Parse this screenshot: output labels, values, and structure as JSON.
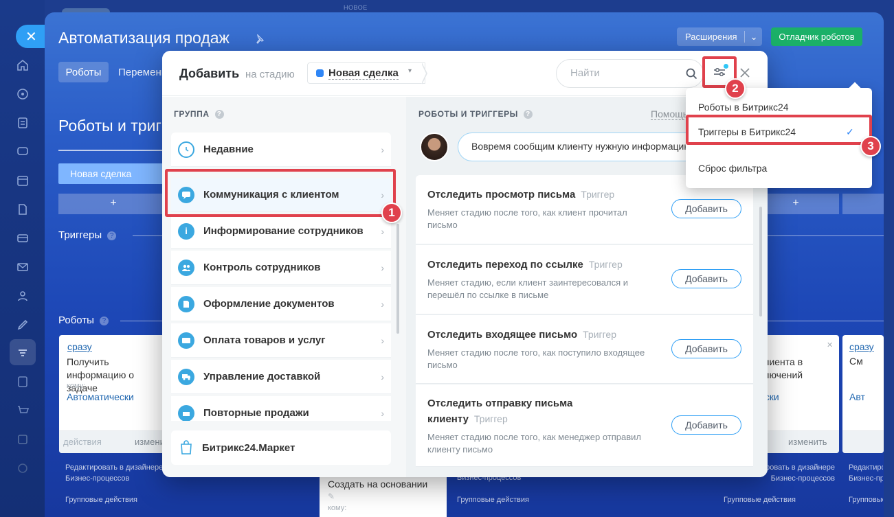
{
  "window": {
    "new_badge": "НОВОЕ"
  },
  "sidebar": {
    "icons": [
      "home-icon",
      "activity-icon",
      "tasks-icon",
      "chat-icon",
      "calendar-icon",
      "documents-icon",
      "card-icon",
      "mail-icon",
      "contacts-icon",
      "sign-icon",
      "filter-icon",
      "form-icon",
      "cart-icon",
      "chart-icon",
      "settings-icon"
    ]
  },
  "page": {
    "title": "Автоматизация продаж",
    "extensions_label": "Расширения",
    "debugger_label": "Отладчик роботов",
    "tabs": [
      "Роботы",
      "Переменные"
    ],
    "bg_title": "Роботы и триггеры",
    "stage": "Новая сделка",
    "plus": "+",
    "triggers_label": "Триггеры",
    "robots_label": "Роботы",
    "cards": [
      {
        "when": "сразу",
        "title": "Получить информацию о задаче",
        "to_label": "кому:",
        "to_value": "Автоматически",
        "foot_left": "действия",
        "foot_right": "изменить"
      },
      {
        "title": "Создать на основании",
        "to_label": "кому:"
      },
      {
        "title_partial": "клиента в",
        "title_partial2": "ключений",
        "to_value": "ески",
        "foot_right": "изменить"
      },
      {
        "when": "сразу",
        "title_partial": "См",
        "to_value": "Авт"
      }
    ],
    "links": {
      "edit_designer_1": "Редактировать в дизайнере",
      "edit_designer_2": "Бизнес-процессов",
      "group_actions": "Групповые действия",
      "edit_designer_short": "Редактировать в дизайнере",
      "bp_short": "Бизнес-процессов"
    }
  },
  "modal": {
    "title": "Добавить",
    "stage_label": "на стадию",
    "stage_value": "Новая сделка",
    "search_placeholder": "Найти",
    "group_header": "ГРУППА",
    "groups": [
      {
        "label": "Недавние"
      },
      {
        "label": "Коммуникация с клиентом"
      },
      {
        "label": "Информирование сотрудников"
      },
      {
        "label": "Контроль сотрудников"
      },
      {
        "label": "Оформление документов"
      },
      {
        "label": "Оплата товаров и услуг"
      },
      {
        "label": "Управление доставкой"
      },
      {
        "label": "Повторные продажи"
      }
    ],
    "market": "Битрикс24.Маркет",
    "right_header": "РОБОТЫ И ТРИГГЕРЫ",
    "help": "Помощь",
    "hint": "Вовремя сообщим клиенту нужную информацию",
    "add_label": "Добавить",
    "trigger_kind": "Триггер",
    "triggers": [
      {
        "title": "Отследить просмотр письма",
        "desc": "Меняет стадию после того, как клиент прочитал письмо"
      },
      {
        "title": "Отследить переход по ссылке",
        "desc": "Меняет стадию, если клиент заинтересовался и перешёл по ссылке в письме"
      },
      {
        "title": "Отследить входящее письмо",
        "desc": "Меняет стадию после того, как поступило входящее письмо"
      },
      {
        "title_line1": "Отследить отправку письма",
        "title_line2": "клиенту",
        "desc": "Меняет стадию после того, как менеджер отправил клиенту письмо"
      }
    ]
  },
  "dropdown": {
    "items": [
      "Роботы в Битрикс24",
      "Триггеры в Битрикс24",
      "Сброс фильтра"
    ],
    "checked": "✓"
  },
  "badges": {
    "b1": "1",
    "b2": "2",
    "b3": "3"
  },
  "colors": {
    "accent": "#2f9ff5",
    "highlight": "#e0414c",
    "success": "#1bb068"
  }
}
